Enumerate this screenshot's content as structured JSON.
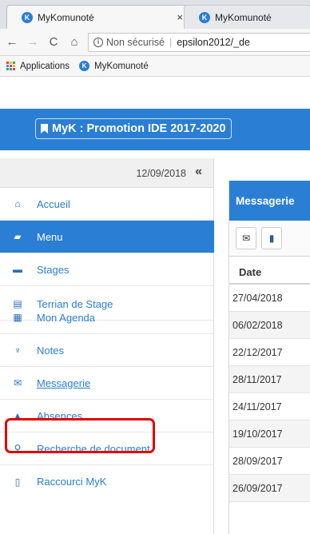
{
  "browser": {
    "tabs": [
      {
        "title": "MyKomunoté",
        "close": "×",
        "favicon": "K"
      },
      {
        "title": "MyKomunoté",
        "favicon": "K"
      }
    ],
    "nav": {
      "back": "←",
      "forward": "→",
      "reload": "C",
      "home": "⌂"
    },
    "omnibox": {
      "security": "Non sécurisé",
      "url": "epsilon2012/_de"
    },
    "bookmarks": [
      {
        "label": "Applications",
        "icon": "apps-grid-icon"
      },
      {
        "label": "MyKomunoté",
        "icon": "mykomunote-favicon"
      }
    ]
  },
  "app": {
    "brand": "MyK : Promotion IDE 2017-2020",
    "accent_color": "#2a7ed3"
  },
  "sidebar": {
    "date": "12/09/2018",
    "collapse": "«",
    "items": [
      {
        "label": "Accueil",
        "icon": "home-icon",
        "glyph": "⌂"
      },
      {
        "label": "Menu",
        "icon": "book-icon",
        "glyph": "▰"
      },
      {
        "label": "Stages",
        "icon": "folder-icon",
        "glyph": "▬"
      },
      {
        "label": "Terrian de Stage",
        "icon": "archive-icon",
        "glyph": "▤"
      },
      {
        "label": "Mon Agenda",
        "icon": "calendar-icon",
        "glyph": "▦"
      },
      {
        "label": "Notes",
        "icon": "trophy-icon",
        "glyph": "♆"
      },
      {
        "label": "Messagerie",
        "icon": "envelope-icon",
        "glyph": "✉"
      },
      {
        "label": "Absences",
        "icon": "bell-icon",
        "glyph": "▲"
      },
      {
        "label": "Recherche de document",
        "icon": "search-icon",
        "glyph": "⚲"
      },
      {
        "label": "Raccourci MyK",
        "icon": "mobile-icon",
        "glyph": "▯"
      }
    ]
  },
  "panel": {
    "title": "Messagerie",
    "column": "Date",
    "rows": [
      "27/04/2018",
      "06/02/2018",
      "22/12/2017",
      "28/11/2017",
      "24/11/2017",
      "19/10/2017",
      "28/09/2017",
      "26/09/2017"
    ]
  }
}
